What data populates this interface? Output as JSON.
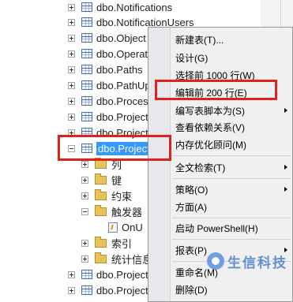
{
  "tree": {
    "items": [
      {
        "label": "dbo.Notifications"
      },
      {
        "label": "dbo.NotificationUsers"
      },
      {
        "label": "dbo.Object"
      },
      {
        "label": "dbo.Operat"
      },
      {
        "label": "dbo.Paths"
      },
      {
        "label": "dbo.PathUp"
      },
      {
        "label": "dbo.Proces"
      },
      {
        "label": "dbo.Project"
      },
      {
        "label": "dbo.Project"
      },
      {
        "label": "dbo.Project"
      },
      {
        "label": "列"
      },
      {
        "label": "键"
      },
      {
        "label": "约束"
      },
      {
        "label": "触发器"
      },
      {
        "label": "OnU"
      },
      {
        "label": "索引"
      },
      {
        "label": "统计信息"
      },
      {
        "label": "dbo.Project"
      },
      {
        "label": "dbo.Project"
      }
    ]
  },
  "menu": {
    "items": [
      {
        "label": "新建表(T)..."
      },
      {
        "label": "设计(G)"
      },
      {
        "label": "选择前 1000 行(W)"
      },
      {
        "label": "编辑前 200 行(E)"
      },
      {
        "label": "编写表脚本为(S)"
      },
      {
        "label": "查看依赖关系(V)"
      },
      {
        "label": "内存优化顾问(M)"
      },
      {
        "label": "全文检索(T)"
      },
      {
        "label": "策略(O)"
      },
      {
        "label": "方面(A)"
      },
      {
        "label": "启动 PowerShell(H)"
      },
      {
        "label": "报表(P)"
      },
      {
        "label": "重命名(M)"
      },
      {
        "label": "删除(D)"
      }
    ]
  },
  "watermark": {
    "text": "生信科技"
  },
  "colors": {
    "selection": "#3399ff",
    "callout": "#e0211d"
  }
}
